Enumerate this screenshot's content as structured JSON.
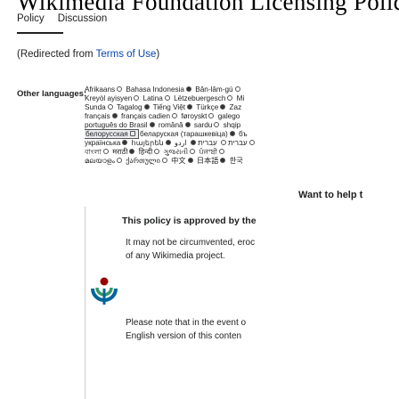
{
  "page": {
    "title": "Wikimedia Foundation Licensing Policy"
  },
  "tabs": [
    {
      "label": "Policy",
      "active": true
    },
    {
      "label": "Discussion",
      "active": false
    }
  ],
  "redirect": {
    "prefix": "(Redirected from ",
    "link_text": "Terms of Use",
    "suffix": ")"
  },
  "languages": {
    "label": "Other languages:",
    "rows": [
      [
        {
          "name": "Afrikaans",
          "mark": "off"
        },
        {
          "name": "Bahasa Indonesia",
          "mark": "on"
        },
        {
          "name": "Bân-lâm-gú",
          "mark": "off"
        }
      ],
      [
        {
          "name": "Kreyòl ayisyen",
          "mark": "off"
        },
        {
          "name": "Latina",
          "mark": "off"
        },
        {
          "name": "Lëtzebuergesch",
          "mark": "off"
        },
        {
          "name": "Mi",
          "mark": "none"
        }
      ],
      [
        {
          "name": "Sunda",
          "mark": "off"
        },
        {
          "name": "Tagalog",
          "mark": "on"
        },
        {
          "name": "Tiếng Việt",
          "mark": "on"
        },
        {
          "name": "Türkçe",
          "mark": "on"
        },
        {
          "name": "Zaz",
          "mark": "none"
        }
      ],
      [
        {
          "name": "français",
          "mark": "on"
        },
        {
          "name": "français cadien",
          "mark": "off"
        },
        {
          "name": "føroyskt",
          "mark": "off"
        },
        {
          "name": "galego",
          "mark": "none"
        }
      ],
      [
        {
          "name": "português do Brasil",
          "mark": "on"
        },
        {
          "name": "română",
          "mark": "on"
        },
        {
          "name": "sardu",
          "mark": "off"
        },
        {
          "name": "shqip",
          "mark": "none"
        }
      ],
      [
        {
          "name": "белорусская",
          "mark": "box",
          "selected": true
        },
        {
          "name": "беларуская (тарашкевіца)",
          "mark": "on"
        },
        {
          "name": "бъ",
          "mark": "none"
        }
      ],
      [
        {
          "name": "українська",
          "mark": "on"
        },
        {
          "name": "հայերեն",
          "mark": "on"
        },
        {
          "name": "עברית",
          "mark": "off"
        },
        {
          "name": "עברית",
          "mark": "on"
        },
        {
          "name": "اردو",
          "mark": "off"
        }
      ],
      [
        {
          "name": "বাংলা",
          "mark": "off"
        },
        {
          "name": "मराठी",
          "mark": "on"
        },
        {
          "name": "हिन्दी",
          "mark": "off"
        },
        {
          "name": "ગુજરાતી",
          "mark": "off"
        },
        {
          "name": "ਪੰਜਾਬੀ",
          "mark": "off"
        }
      ],
      [
        {
          "name": "മലയാളം",
          "mark": "off"
        },
        {
          "name": "ქართული",
          "mark": "off"
        },
        {
          "name": "中文",
          "mark": "on"
        },
        {
          "name": "日本語",
          "mark": "on"
        },
        {
          "name": "한국",
          "mark": "none"
        }
      ]
    ]
  },
  "help": {
    "title": "Want to help t"
  },
  "policy": {
    "heading": "This policy is approved by the",
    "lines": [
      "It may not be circumvented, eroc",
      "of any Wikimedia project."
    ],
    "foot": [
      "Please note that in the event o",
      "English version of this conten"
    ]
  }
}
